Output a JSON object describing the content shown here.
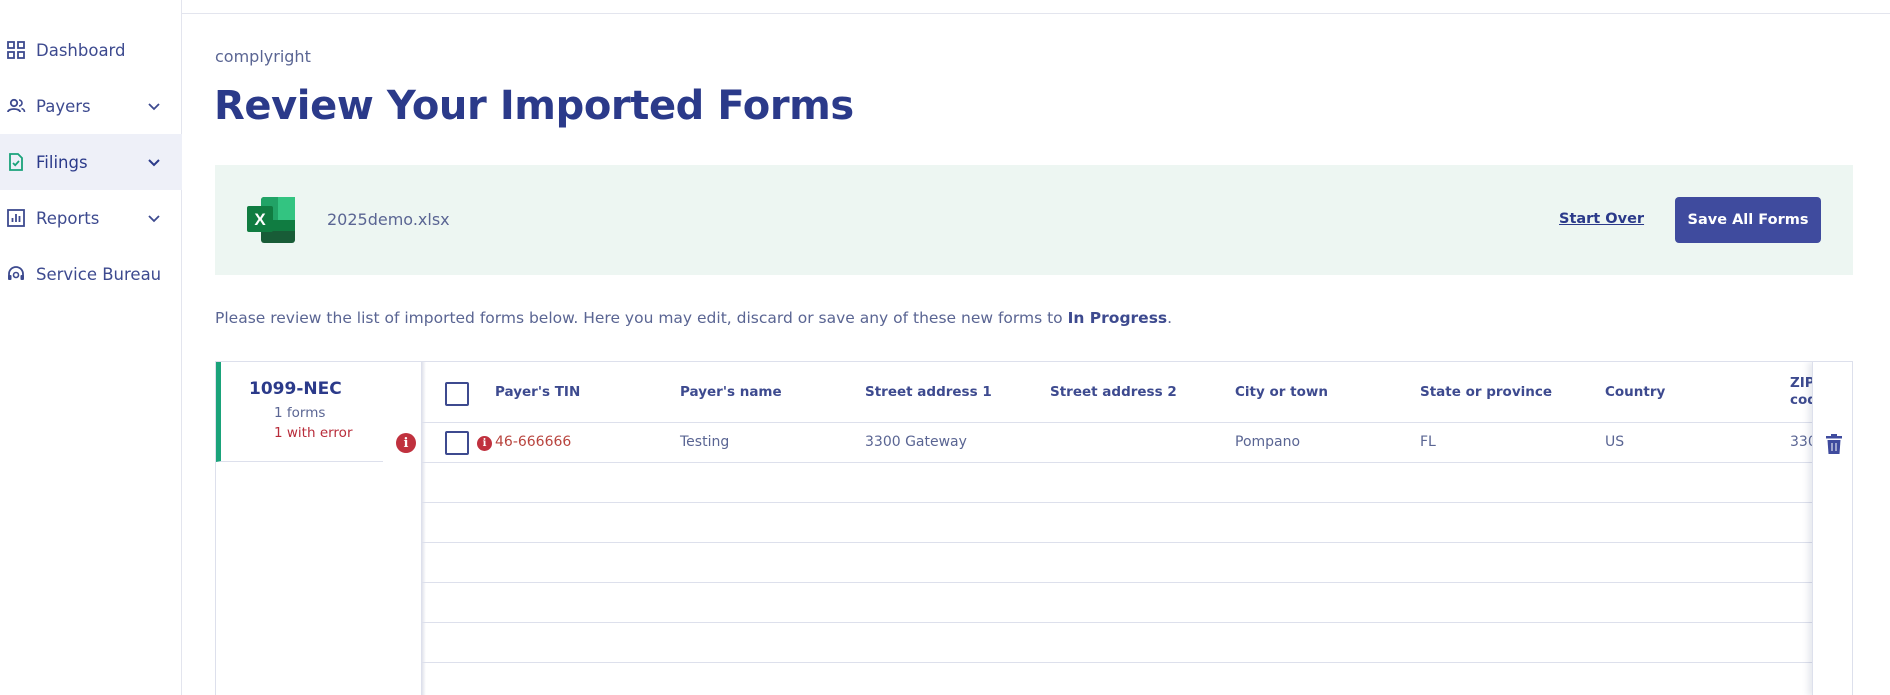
{
  "sidebar": {
    "items": [
      {
        "label": "Dashboard",
        "icon": "grid-icon",
        "expandable": false,
        "active": false
      },
      {
        "label": "Payers",
        "icon": "users-icon",
        "expandable": true,
        "active": false
      },
      {
        "label": "Filings",
        "icon": "document-check-icon",
        "expandable": true,
        "active": true
      },
      {
        "label": "Reports",
        "icon": "bar-chart-icon",
        "expandable": true,
        "active": false
      },
      {
        "label": "Service Bureau",
        "icon": "headset-icon",
        "expandable": false,
        "active": false
      }
    ]
  },
  "header": {
    "brand": "complyright",
    "title": "Review Your Imported Forms"
  },
  "file_banner": {
    "file_name": "2025demo.xlsx",
    "start_over_label": "Start Over",
    "save_all_label": "Save All Forms"
  },
  "instructions": {
    "text": "Please review the list of imported forms below. Here you may edit, discard or save any of these new forms to ",
    "emphasis": "In Progress",
    "suffix": "."
  },
  "form_types": [
    {
      "name": "1099-NEC",
      "count_text": "1 forms",
      "error_text": "1 with error"
    }
  ],
  "table": {
    "columns": [
      "Payer's TIN",
      "Payer's name",
      "Street address 1",
      "Street address 2",
      "City or town",
      "State or province",
      "Country",
      "ZIP code"
    ],
    "rows": [
      {
        "tin": "46-666666",
        "name": "Testing",
        "street1": "3300 Gateway",
        "street2": "",
        "city": "Pompano",
        "state": "FL",
        "country": "US",
        "zip": "330"
      }
    ]
  },
  "colors": {
    "primary": "#3f4b9e",
    "heading": "#2b3a8a",
    "error": "#c0313e",
    "success_accent": "#1aa37a",
    "banner_bg": "#edf6f2"
  }
}
